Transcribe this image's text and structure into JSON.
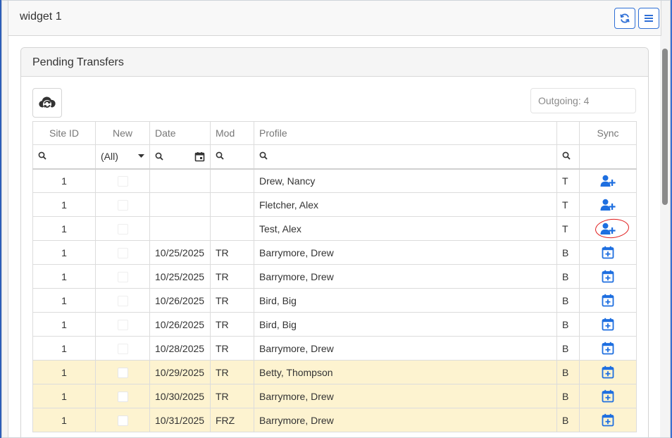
{
  "window": {
    "title": "widget 1"
  },
  "header_buttons": {
    "refresh_icon": "refresh-icon",
    "menu_icon": "hamburger-menu-icon",
    "accent": "#2f6fd6"
  },
  "panel": {
    "title": "Pending Transfers",
    "outgoing_placeholder": "Outgoing: 4"
  },
  "columns": {
    "site_id": "Site ID",
    "new": "New",
    "date": "Date",
    "mod": "Mod",
    "profile": "Profile",
    "type": "",
    "sync": "Sync"
  },
  "filters": {
    "new_selected": "(All)"
  },
  "rows": [
    {
      "site_id": "1",
      "date": "",
      "mod": "",
      "profile": "Drew, Nancy",
      "type": "T",
      "sync_icon": "user-add-icon",
      "highlight": false
    },
    {
      "site_id": "1",
      "date": "",
      "mod": "",
      "profile": "Fletcher, Alex",
      "type": "T",
      "sync_icon": "user-add-icon",
      "highlight": false
    },
    {
      "site_id": "1",
      "date": "",
      "mod": "",
      "profile": "Test, Alex",
      "type": "T",
      "sync_icon": "user-add-icon",
      "highlight": false
    },
    {
      "site_id": "1",
      "date": "10/25/2025",
      "mod": "TR",
      "profile": "Barrymore, Drew",
      "type": "B",
      "sync_icon": "calendar-add-icon",
      "highlight": false
    },
    {
      "site_id": "1",
      "date": "10/25/2025",
      "mod": "TR",
      "profile": "Barrymore, Drew",
      "type": "B",
      "sync_icon": "calendar-add-icon",
      "highlight": false
    },
    {
      "site_id": "1",
      "date": "10/26/2025",
      "mod": "TR",
      "profile": "Bird, Big",
      "type": "B",
      "sync_icon": "calendar-add-icon",
      "highlight": false
    },
    {
      "site_id": "1",
      "date": "10/26/2025",
      "mod": "TR",
      "profile": "Bird, Big",
      "type": "B",
      "sync_icon": "calendar-add-icon",
      "highlight": false
    },
    {
      "site_id": "1",
      "date": "10/28/2025",
      "mod": "TR",
      "profile": "Barrymore, Drew",
      "type": "B",
      "sync_icon": "calendar-add-icon",
      "highlight": false
    },
    {
      "site_id": "1",
      "date": "10/29/2025",
      "mod": "TR",
      "profile": "Betty, Thompson",
      "type": "B",
      "sync_icon": "calendar-add-icon",
      "highlight": true
    },
    {
      "site_id": "1",
      "date": "10/30/2025",
      "mod": "TR",
      "profile": "Barrymore, Drew",
      "type": "B",
      "sync_icon": "calendar-add-icon",
      "highlight": true
    },
    {
      "site_id": "1",
      "date": "10/31/2025",
      "mod": "FRZ",
      "profile": "Barrymore, Drew",
      "type": "B",
      "sync_icon": "calendar-add-icon",
      "highlight": true
    }
  ],
  "colors": {
    "highlight_row": "#fdf3d0",
    "sync_icon": "#1e6fe0",
    "annotation": "#e01c1c"
  }
}
